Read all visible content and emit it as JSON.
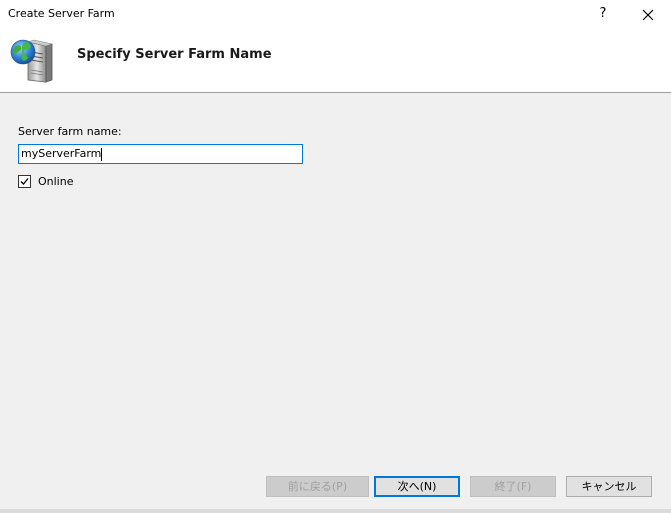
{
  "window": {
    "title": "Create Server Farm",
    "help_label": "?"
  },
  "header": {
    "title": "Specify Server Farm Name",
    "icon": "server-globe-icon"
  },
  "form": {
    "farm_name_label": "Server farm name:",
    "farm_name_value": "myServerFarm",
    "online_label": "Online",
    "online_checked": true
  },
  "buttons": {
    "back_label": "前に戻る(P)",
    "next_label": "次へ(N)",
    "finish_label": "終了(F)",
    "cancel_label": "キャンセル"
  },
  "colors": {
    "focus_border": "#0078d7",
    "header_background": "#ffffff",
    "body_background": "#f0f0f0"
  }
}
